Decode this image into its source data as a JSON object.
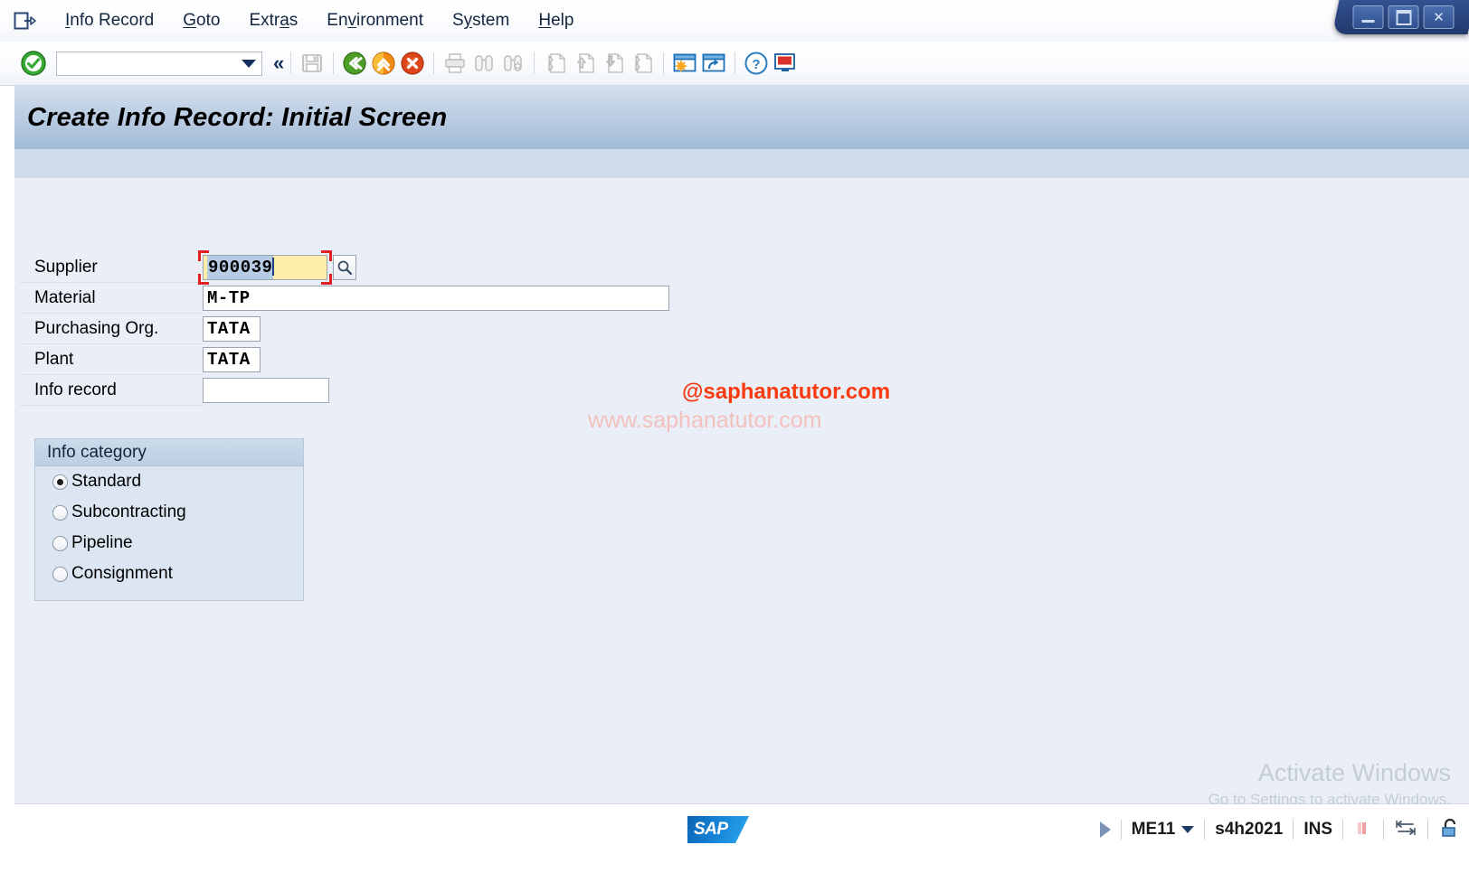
{
  "menu": {
    "system_icon": "window-menu-icon",
    "items": [
      {
        "label": "Info Record",
        "accel": "I"
      },
      {
        "label": "Goto",
        "accel": "G"
      },
      {
        "label": "Extras",
        "accel": "a"
      },
      {
        "label": "Environment",
        "accel": "v"
      },
      {
        "label": "System",
        "accel": "y"
      },
      {
        "label": "Help",
        "accel": "H"
      }
    ]
  },
  "window_controls": {
    "minimize": "minimize-icon",
    "restore": "restore-icon",
    "close": "✕"
  },
  "toolbar": {
    "enter_icon": "green-check-enter-icon",
    "command_field_value": "",
    "command_field_placeholder": "",
    "collapse_label": "«",
    "buttons": [
      {
        "name": "save-button",
        "icon": "save-floppy-icon",
        "enabled": false
      },
      {
        "name": "back-button",
        "icon": "green-back-arrow-icon",
        "enabled": true
      },
      {
        "name": "exit-button",
        "icon": "orange-exit-up-arrow-icon",
        "enabled": true
      },
      {
        "name": "cancel-button",
        "icon": "red-cancel-x-icon",
        "enabled": true
      },
      {
        "name": "print-button",
        "icon": "printer-icon",
        "enabled": false
      },
      {
        "name": "find-button",
        "icon": "binoculars-find-icon",
        "enabled": false
      },
      {
        "name": "find-next-button",
        "icon": "binoculars-plus-find-next-icon",
        "enabled": false
      },
      {
        "name": "first-page-button",
        "icon": "first-page-icon",
        "enabled": false
      },
      {
        "name": "previous-page-button",
        "icon": "previous-page-up-icon",
        "enabled": false
      },
      {
        "name": "next-page-button",
        "icon": "next-page-down-icon",
        "enabled": false
      },
      {
        "name": "last-page-button",
        "icon": "last-page-icon",
        "enabled": false
      },
      {
        "name": "create-session-button",
        "icon": "new-session-window-icon",
        "enabled": true
      },
      {
        "name": "create-shortcut-button",
        "icon": "shortcut-window-arrow-icon",
        "enabled": true
      },
      {
        "name": "help-button",
        "icon": "question-mark-help-icon",
        "enabled": true
      },
      {
        "name": "customize-layout-button",
        "icon": "customize-local-layout-icon",
        "enabled": true
      }
    ]
  },
  "page": {
    "title": "Create Info Record: Initial Screen"
  },
  "form": {
    "fields": [
      {
        "label": "Supplier",
        "value": "900039",
        "name": "supplier",
        "focused": true,
        "has_f4": true
      },
      {
        "label": "Material",
        "value": "M-TP",
        "name": "material",
        "focused": false,
        "has_f4": false
      },
      {
        "label": "Purchasing Org.",
        "value": "TATA",
        "name": "purchasing-org",
        "focused": false,
        "has_f4": false
      },
      {
        "label": "Plant",
        "value": "TATA",
        "name": "plant",
        "focused": false,
        "has_f4": false
      },
      {
        "label": "Info record",
        "value": "",
        "name": "info-record",
        "focused": false,
        "has_f4": false
      }
    ],
    "f4_icon": "search-magnifier-icon"
  },
  "info_category": {
    "legend": "Info category",
    "options": [
      {
        "label": "Standard",
        "selected": true
      },
      {
        "label": "Subcontracting",
        "selected": false
      },
      {
        "label": "Pipeline",
        "selected": false
      },
      {
        "label": "Consignment",
        "selected": false
      }
    ]
  },
  "watermarks": {
    "brand": "@saphanatutor.com",
    "url": "www.saphanatutor.com",
    "activate_title": "Activate Windows",
    "activate_sub": "Go to Settings to activate Windows."
  },
  "status_bar": {
    "logo_text": "SAP",
    "expand_icon": "expand-triangle-icon",
    "transaction": "ME11",
    "system": "s4h2021",
    "insert_mode": "INS",
    "signal_icon": "server-load-bars-icon",
    "response_icon": "response-time-arrows-icon",
    "lock_icon": "unlocked-padlock-icon"
  },
  "colors": {
    "title_band": "#a9c0da",
    "canvas": "#eaeff7",
    "focus_highlight": "#fdeeaa",
    "focus_frame": "#e02020",
    "selection": "#b6cbe4",
    "brand_red": "#f93a10",
    "sap_blue": "#1681d4"
  }
}
